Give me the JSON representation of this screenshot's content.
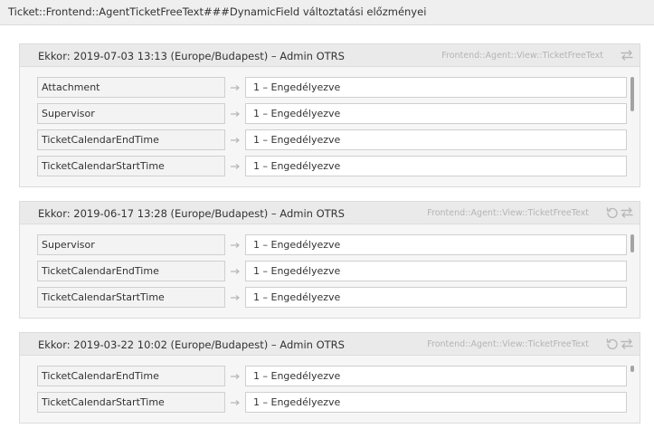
{
  "page": {
    "title": "Ticket::Frontend::AgentTicketFreeText###DynamicField változtatási előzményei"
  },
  "colors": {
    "header_bg": "#efefef",
    "box_bg": "#f6f6f6",
    "box_header_bg": "#eaeaea",
    "muted_text": "#b4b4b4",
    "icon": "#b8b8b8"
  },
  "history": [
    {
      "title": "Ekkor: 2019-07-03 13:13 (Europe/Budapest) – Admin OTRS",
      "source": "Frontend::Agent::View::TicketFreeText",
      "icons": [
        "compare-icon"
      ],
      "rows": [
        {
          "name": "Attachment",
          "value": "1 – Engedélyezve"
        },
        {
          "name": "Supervisor",
          "value": "1 – Engedélyezve"
        },
        {
          "name": "TicketCalendarEndTime",
          "value": "1 – Engedélyezve"
        },
        {
          "name": "TicketCalendarStartTime",
          "value": "1 – Engedélyezve"
        }
      ]
    },
    {
      "title": "Ekkor: 2019-06-17 13:28 (Europe/Budapest) – Admin OTRS",
      "source": "Frontend::Agent::View::TicketFreeText",
      "icons": [
        "restore-icon",
        "compare-icon"
      ],
      "rows": [
        {
          "name": "Supervisor",
          "value": "1 – Engedélyezve"
        },
        {
          "name": "TicketCalendarEndTime",
          "value": "1 – Engedélyezve"
        },
        {
          "name": "TicketCalendarStartTime",
          "value": "1 – Engedélyezve"
        }
      ]
    },
    {
      "title": "Ekkor: 2019-03-22 10:02 (Europe/Budapest) – Admin OTRS",
      "source": "Frontend::Agent::View::TicketFreeText",
      "icons": [
        "restore-icon",
        "compare-icon"
      ],
      "rows": [
        {
          "name": "TicketCalendarEndTime",
          "value": "1 – Engedélyezve"
        },
        {
          "name": "TicketCalendarStartTime",
          "value": "1 – Engedélyezve"
        }
      ]
    }
  ]
}
